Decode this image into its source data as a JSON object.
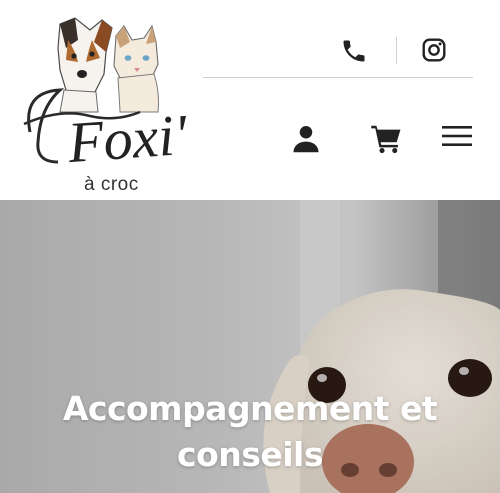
{
  "header": {
    "logo": {
      "wordmark": "Foxi'",
      "tagline": "à croc"
    },
    "contact": {
      "phone_icon": "phone-icon",
      "instagram_icon": "instagram-icon"
    },
    "actions": {
      "account_icon": "user-icon",
      "cart_icon": "cart-icon",
      "menu_icon": "hamburger-menu-icon"
    }
  },
  "hero": {
    "title_line1": "Accompagnement et",
    "title_line2": "conseils"
  },
  "colors": {
    "icon": "#222222",
    "divider": "#cfcfcf",
    "hero_text": "#ffffff"
  }
}
